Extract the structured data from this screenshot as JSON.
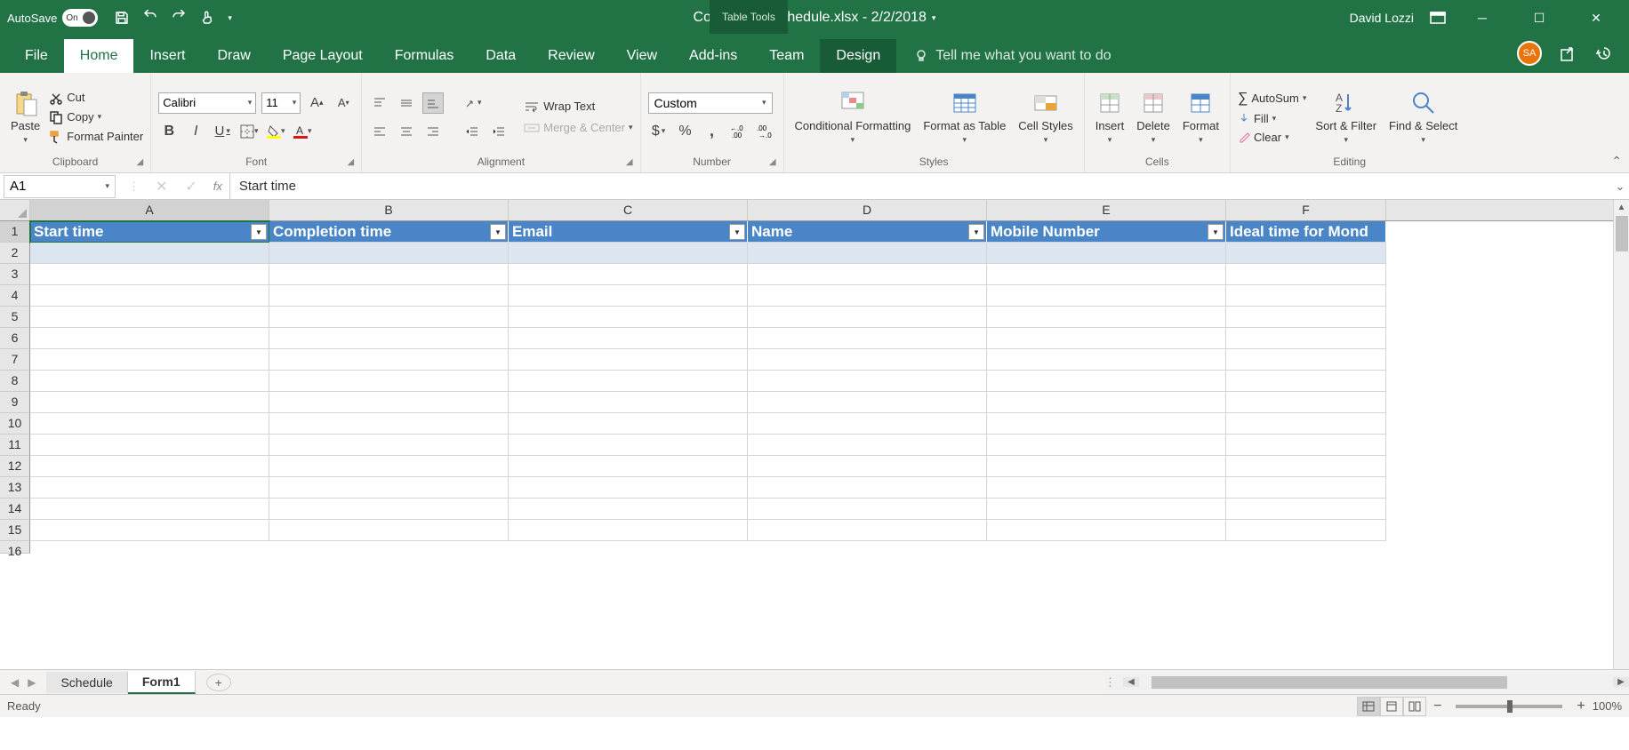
{
  "titlebar": {
    "autosave_label": "AutoSave",
    "autosave_on": "On",
    "document_title": "Conference Schedule.xlsx - 2/2/2018",
    "table_tools": "Table Tools",
    "user_name": "David Lozzi"
  },
  "tabs": {
    "file": "File",
    "home": "Home",
    "insert": "Insert",
    "draw": "Draw",
    "page_layout": "Page Layout",
    "formulas": "Formulas",
    "data": "Data",
    "review": "Review",
    "view": "View",
    "addins": "Add-ins",
    "team": "Team",
    "design": "Design",
    "tellme": "Tell me what you want to do"
  },
  "avatar_initials": "SA",
  "ribbon": {
    "paste": "Paste",
    "cut": "Cut",
    "copy": "Copy",
    "format_painter": "Format Painter",
    "clipboard": "Clipboard",
    "font_name": "Calibri",
    "font_size": "11",
    "font": "Font",
    "wrap_text": "Wrap Text",
    "merge_center": "Merge & Center",
    "alignment": "Alignment",
    "number_format": "Custom",
    "number": "Number",
    "conditional_formatting": "Conditional Formatting",
    "format_as_table": "Format as Table",
    "cell_styles": "Cell Styles",
    "styles": "Styles",
    "insert_btn": "Insert",
    "delete_btn": "Delete",
    "format_btn": "Format",
    "cells": "Cells",
    "autosum": "AutoSum",
    "fill": "Fill",
    "clear": "Clear",
    "sort_filter": "Sort & Filter",
    "find_select": "Find & Select",
    "editing": "Editing"
  },
  "formula_bar": {
    "cell_ref": "A1",
    "value": "Start time"
  },
  "columns": [
    "A",
    "B",
    "C",
    "D",
    "E",
    "F"
  ],
  "rows": [
    "1",
    "2",
    "3",
    "4",
    "5",
    "6",
    "7",
    "8",
    "9",
    "10",
    "11",
    "12",
    "13",
    "14",
    "15",
    "16"
  ],
  "table_headers": {
    "a": "Start time",
    "b": "Completion time",
    "c": "Email",
    "d": "Name",
    "e": "Mobile Number",
    "f": "Ideal time for Mond"
  },
  "sheets": {
    "schedule": "Schedule",
    "form1": "Form1"
  },
  "status": {
    "ready": "Ready",
    "zoom": "100%"
  }
}
